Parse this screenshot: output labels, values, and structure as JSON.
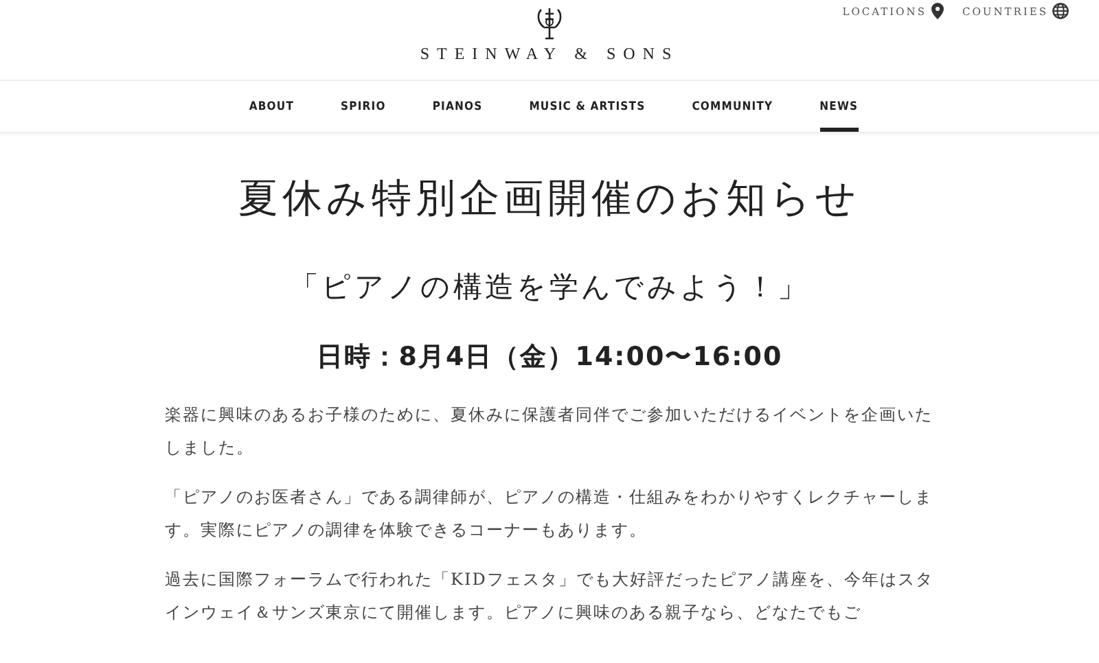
{
  "header": {
    "brand": "STEINWAY & SONS",
    "utility_links": [
      {
        "label": "LOCATIONS",
        "kind": "pin"
      },
      {
        "label": "COUNTRIES",
        "kind": "globe"
      }
    ]
  },
  "nav": [
    {
      "label": "ABOUT",
      "selected": false
    },
    {
      "label": "SPIRIO",
      "selected": false
    },
    {
      "label": "PIANOS",
      "selected": false
    },
    {
      "label": "MUSIC & ARTISTS",
      "selected": false
    },
    {
      "label": "COMMUNITY",
      "selected": false
    },
    {
      "label": "NEWS",
      "selected": true
    }
  ],
  "article": {
    "title": "夏休み特別企画開催のお知らせ",
    "subtitle": "「ピアノの構造を学んでみよう！」",
    "date": "日時：8月4日（金）14:00〜16:00",
    "paragraphs": [
      "楽器に興味のあるお子様のために、夏休みに保護者同伴でご参加いただけるイベントを企画いたしました。",
      "「ピアノのお医者さん」である調律師が、ピアノの構造・仕組みをわかりやすくレクチャーします。実際にピアノの調律を体験できるコーナーもあります。",
      "過去に国際フォーラムで行われた「KIDフェスタ」でも大好評だったピアノ講座を、今年はスタインウェイ＆サンズ東京にて開催します。ピアノに興味のある親子なら、どなたでもご"
    ]
  }
}
